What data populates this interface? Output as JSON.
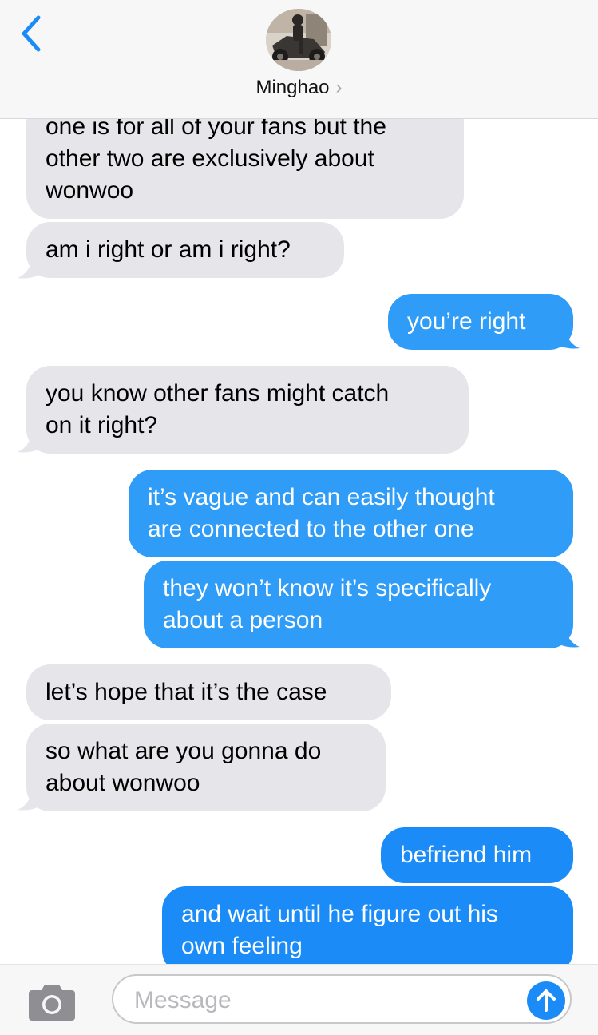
{
  "header": {
    "contact_name": "Minghao",
    "chevron": "›",
    "back_icon": "chevron-left-icon",
    "accent_color": "#1b8cf7"
  },
  "messages": [
    {
      "sender": "contact",
      "lines": [
        "one is for all of your fans but the",
        "other two are exclusively about",
        "wonwoo"
      ]
    },
    {
      "sender": "contact",
      "lines": [
        "am i right or am i right?"
      ]
    },
    {
      "sender": "me",
      "lines": [
        "you’re right"
      ]
    },
    {
      "sender": "contact",
      "lines": [
        "you know other fans might catch",
        "on it right?"
      ]
    },
    {
      "sender": "me",
      "lines": [
        "it’s vague and can easily thought",
        "are connected to the other one"
      ]
    },
    {
      "sender": "me",
      "lines": [
        "they won’t know it’s specifically",
        "about a person"
      ]
    },
    {
      "sender": "contact",
      "lines": [
        "let’s hope that it’s the case"
      ]
    },
    {
      "sender": "contact",
      "lines": [
        "so what are you gonna do",
        "about wonwoo"
      ]
    },
    {
      "sender": "me",
      "lines": [
        "befriend him"
      ]
    },
    {
      "sender": "me",
      "lines": [
        "and wait until he figure out his",
        "own feeling"
      ]
    }
  ],
  "composer": {
    "placeholder": "Message",
    "camera_icon": "camera-icon",
    "send_icon": "arrow-up-icon"
  },
  "colors": {
    "incoming_bubble": "#e5e5ea",
    "outgoing_bubble": "#1b8cf7",
    "header_bg": "#f7f7f7"
  }
}
